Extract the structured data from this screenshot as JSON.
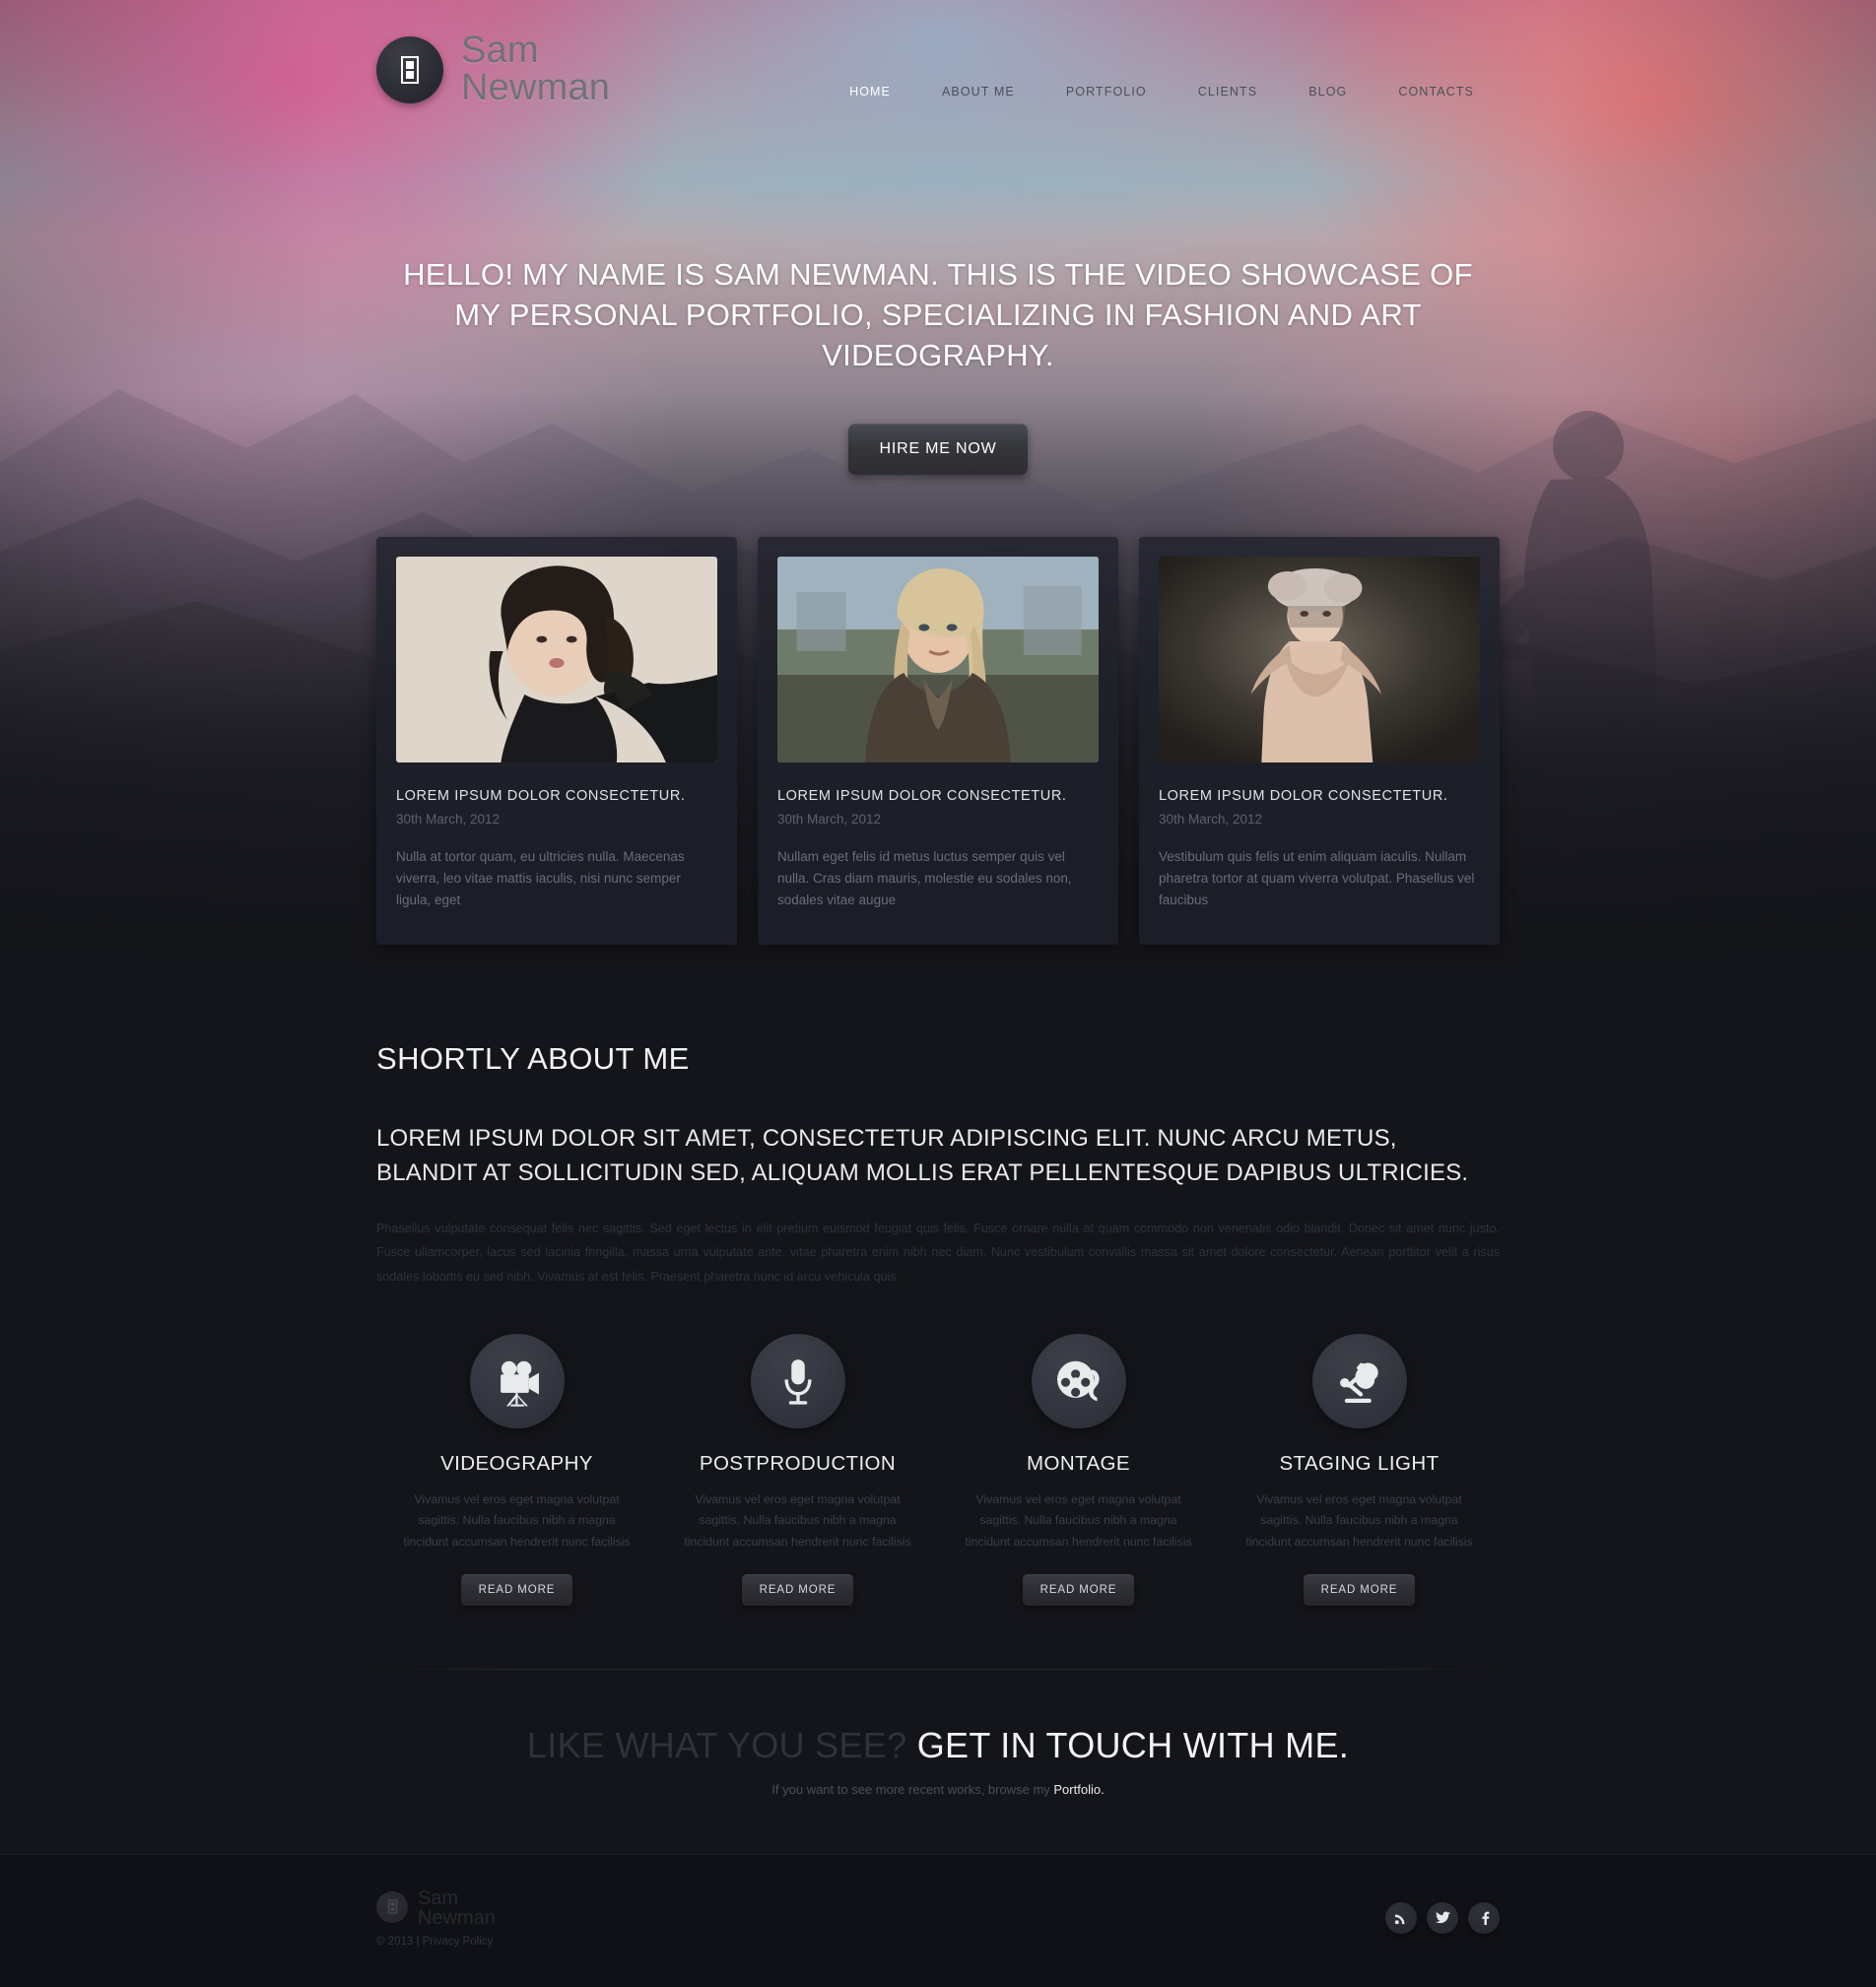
{
  "brand": {
    "line1": "Sam",
    "line2": "Newman",
    "icon": "film-strip-icon"
  },
  "nav": {
    "items": [
      {
        "label": "HOME",
        "active": true
      },
      {
        "label": "ABOUT ME",
        "active": false
      },
      {
        "label": "PORTFOLIO",
        "active": false
      },
      {
        "label": "CLIENTS",
        "active": false
      },
      {
        "label": "BLOG",
        "active": false
      },
      {
        "label": "CONTACTS",
        "active": false
      }
    ]
  },
  "hero": {
    "headline": "HELLO! MY NAME IS SAM NEWMAN. THIS IS THE VIDEO SHOWCASE OF MY PERSONAL PORTFOLIO, SPECIALIZING IN FASHION AND ART VIDEOGRAPHY.",
    "cta_label": "HIRE ME NOW"
  },
  "cards": [
    {
      "title": "LOREM IPSUM DOLOR CONSECTETUR.",
      "date": "30th March, 2012",
      "body": "Nulla at tortor quam, eu ultricies nulla. Maecenas viverra, leo vitae mattis iaculis, nisi nunc semper ligula, eget",
      "image_alt": "portrait-dark-haired-woman"
    },
    {
      "title": "LOREM IPSUM DOLOR CONSECTETUR.",
      "date": "30th March, 2012",
      "body": "Nullam eget felis id metus luctus semper quis vel nulla. Cras diam mauris, molestie eu sodales non, sodales vitae augue",
      "image_alt": "portrait-blonde-woman-outdoors"
    },
    {
      "title": "LOREM IPSUM DOLOR CONSECTETUR.",
      "date": "30th March, 2012",
      "body": "Vestibulum quis felis ut enim aliquam iaculis. Nullam pharetra tortor at quam viverra volutpat. Phasellus vel faucibus",
      "image_alt": "fashion-model-with-headpiece"
    }
  ],
  "about": {
    "title": "SHORTLY ABOUT ME",
    "lead": "LOREM IPSUM DOLOR SIT AMET, CONSECTETUR ADIPISCING ELIT. NUNC ARCU METUS, BLANDIT AT SOLLICITUDIN SED, ALIQUAM MOLLIS ERAT PELLENTESQUE DAPIBUS ULTRICIES.",
    "body": "Phasellus vulputate consequat felis nec sagittis. Sed eget lectus in elit pretium euismod feugiat quis felis. Fusce ornare nulla at quam commodo non venenatis odio blandit. Donec sit amet nunc justo. Fusce ullamcorper, lacus sed lacinia fringilla, massa urna vulputate ante, vitae pharetra enim nibh nec diam. Nunc vestibulum convallis massa sit amet dolore consectetur. Aenean porttitor velit a risus sodales lobortis eu sed nibh. Vivamus at est felis. Praesent pharetra nunc id arcu vehicula quis."
  },
  "services": [
    {
      "name": "VIDEOGRAPHY",
      "icon": "movie-camera-icon",
      "desc": "Vivamus vel eros eget magna volutpat sagittis. Nulla faucibus nibh a magna tincidunt accumsan hendrerit nunc facilisis",
      "button": "READ MORE"
    },
    {
      "name": "POSTPRODUCTION",
      "icon": "microphone-icon",
      "desc": "Vivamus vel eros eget magna volutpat sagittis. Nulla faucibus nibh a magna tincidunt accumsan hendrerit nunc facilisis",
      "button": "READ MORE"
    },
    {
      "name": "MONTAGE",
      "icon": "film-reel-icon",
      "desc": "Vivamus vel eros eget magna volutpat sagittis. Nulla faucibus nibh a magna tincidunt accumsan hendrerit nunc facilisis",
      "button": "READ MORE"
    },
    {
      "name": "STAGING LIGHT",
      "icon": "desk-lamp-icon",
      "desc": "Vivamus vel eros eget magna volutpat sagittis. Nulla faucibus nibh a magna tincidunt accumsan hendrerit nunc facilisis",
      "button": "READ MORE"
    }
  ],
  "cta": {
    "dim_part": "LIKE WHAT YOU SEE?",
    "bright_part": "GET IN TOUCH WITH ME.",
    "sub_prefix": "If you want to see more recent works, browse my ",
    "sub_link": "Portfolio."
  },
  "footer": {
    "brand_line1": "Sam",
    "brand_line2": "Newman",
    "copyright": "© 2013 | Privacy Policy",
    "socials": [
      {
        "name": "rss-icon",
        "label": "RSS"
      },
      {
        "name": "twitter-icon",
        "label": "Twitter"
      },
      {
        "name": "facebook-icon",
        "label": "Facebook"
      }
    ]
  },
  "colors": {
    "page_bg": "#14151a",
    "accent_text": "#ffffff",
    "muted_text": "#686d79",
    "hero_pink": "#c86f95",
    "hero_blue": "#9fb0ba"
  }
}
